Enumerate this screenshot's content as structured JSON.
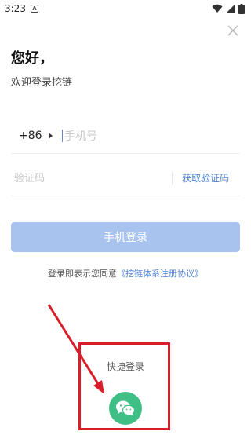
{
  "status_bar": {
    "time": "3:23",
    "notification_letter": "A",
    "icons": [
      "wifi-icon",
      "signal-icon",
      "battery-icon"
    ]
  },
  "header": {
    "greeting": "您好，",
    "welcome": "欢迎登录挖链"
  },
  "form": {
    "country_code": "+86",
    "phone_placeholder": "手机号",
    "code_placeholder": "验证码",
    "get_code_label": "获取验证码",
    "login_label": "手机登录"
  },
  "agreement": {
    "prefix": "登录即表示您同意",
    "link": "《挖链体系注册协议》"
  },
  "quick_login": {
    "label": "快捷登录",
    "icon": "wechat-icon"
  },
  "colors": {
    "accent": "#4d7fcf",
    "login_button": "#a9c3ef",
    "wechat": "#3fbf86",
    "annotation": "#d81e2a"
  }
}
